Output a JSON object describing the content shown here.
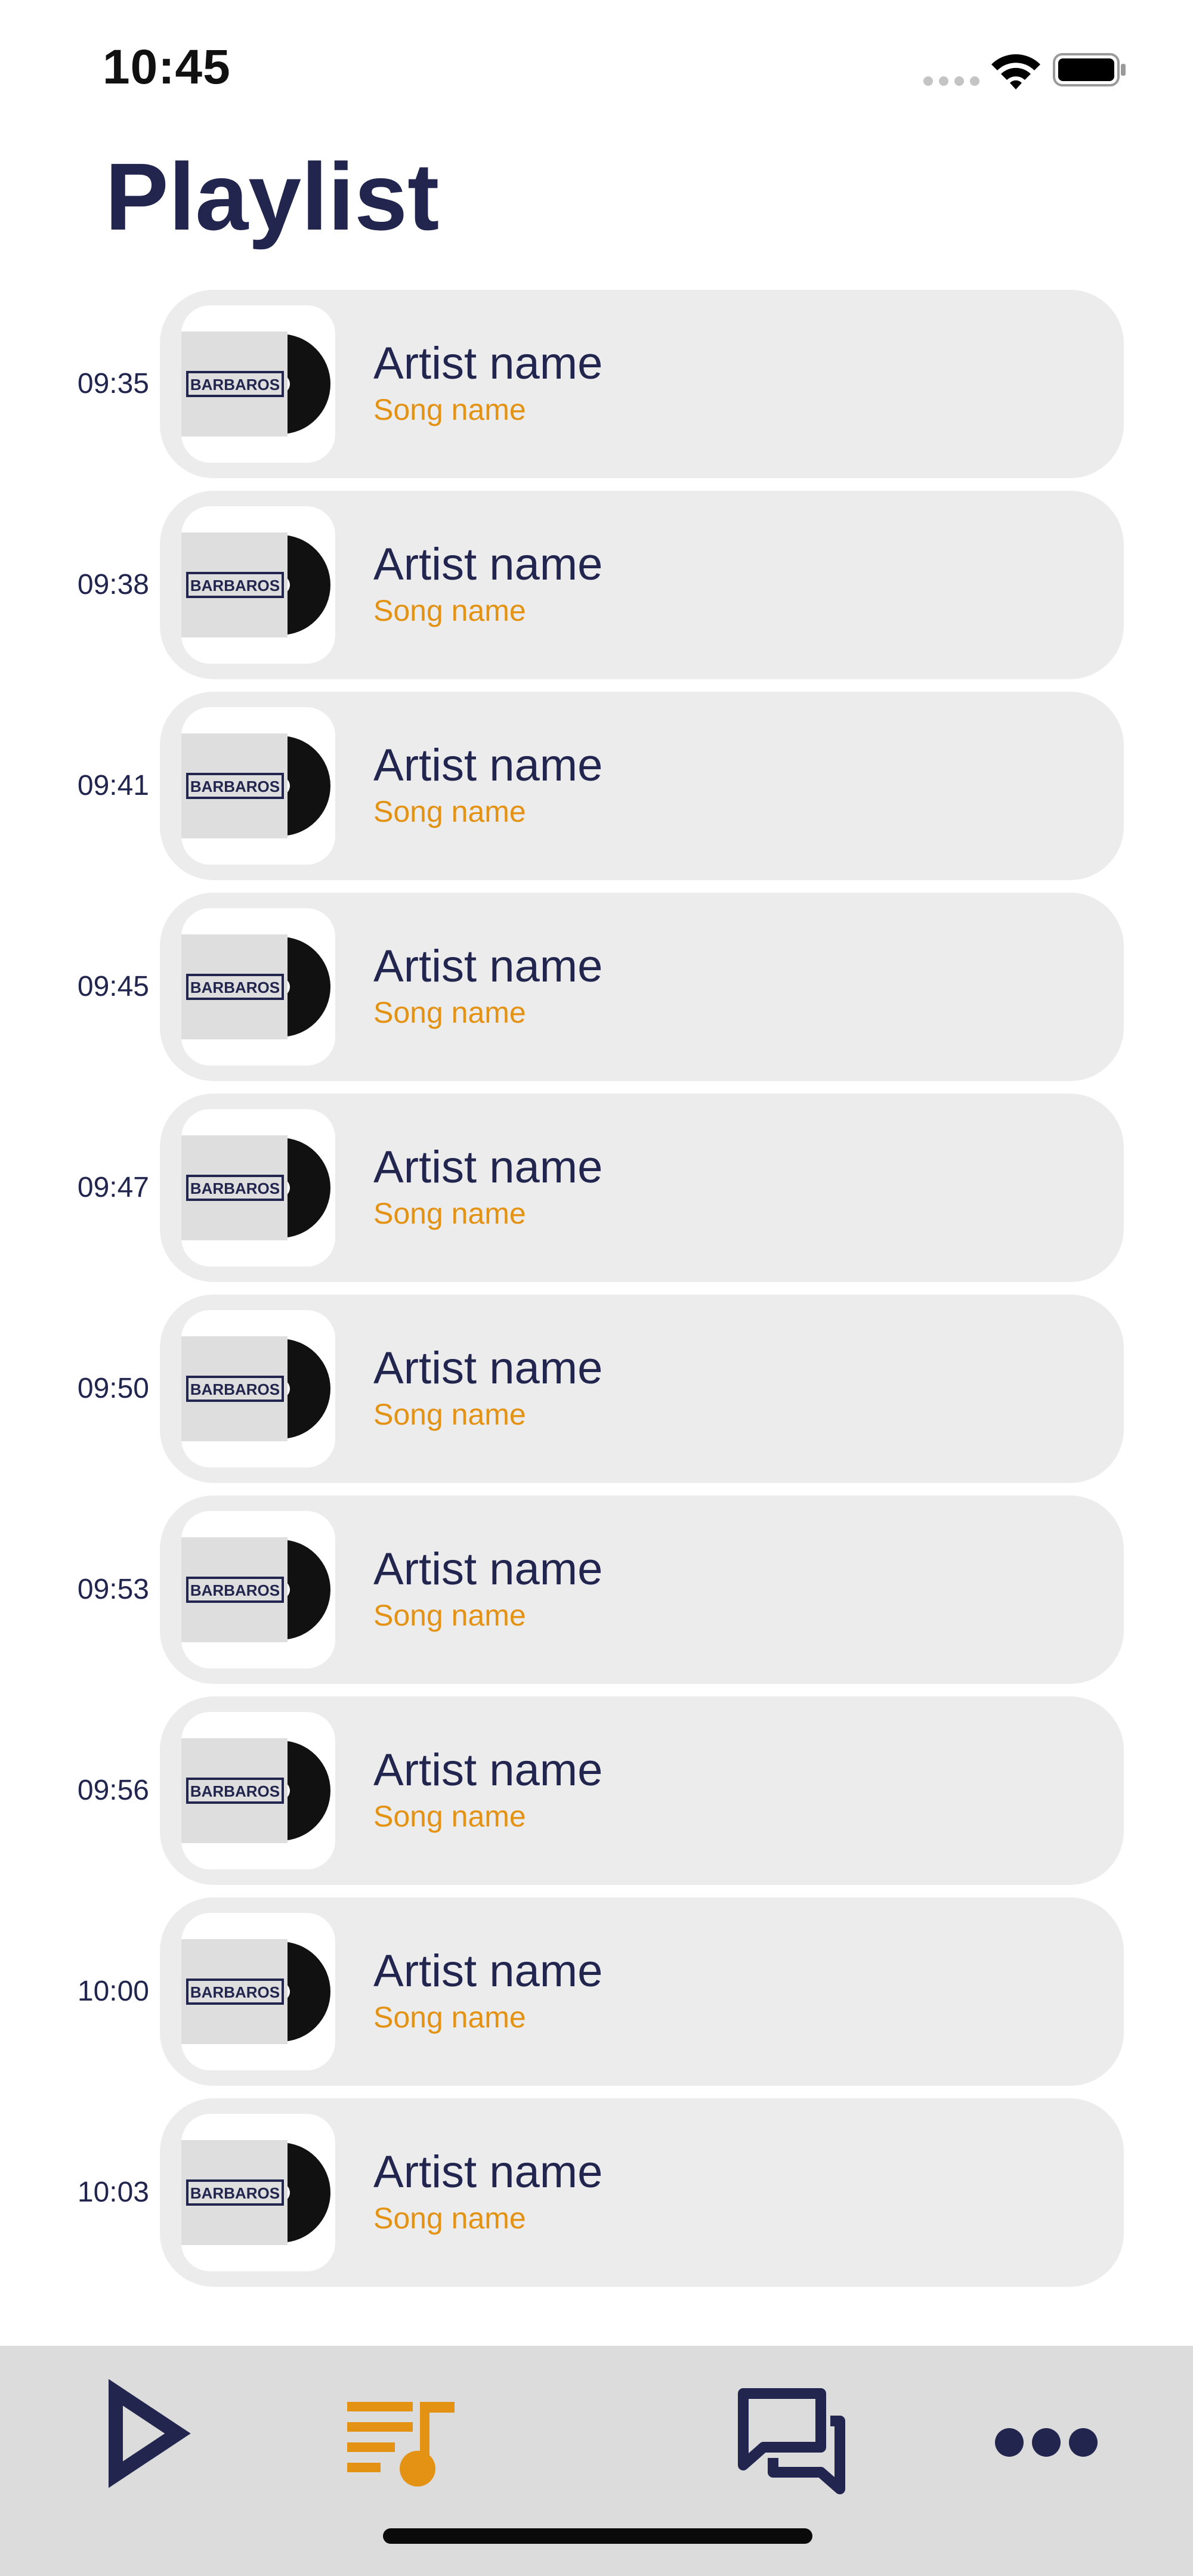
{
  "status_bar": {
    "time": "10:45"
  },
  "header": {
    "title": "Playlist"
  },
  "cover_label": "BARBAROS",
  "playlist": [
    {
      "time": "09:35",
      "artist": "Artist name",
      "song": "Song name"
    },
    {
      "time": "09:38",
      "artist": "Artist name",
      "song": "Song name"
    },
    {
      "time": "09:41",
      "artist": "Artist name",
      "song": "Song name"
    },
    {
      "time": "09:45",
      "artist": "Artist name",
      "song": "Song name"
    },
    {
      "time": "09:47",
      "artist": "Artist name",
      "song": "Song name"
    },
    {
      "time": "09:50",
      "artist": "Artist name",
      "song": "Song name"
    },
    {
      "time": "09:53",
      "artist": "Artist name",
      "song": "Song name"
    },
    {
      "time": "09:56",
      "artist": "Artist name",
      "song": "Song name"
    },
    {
      "time": "10:00",
      "artist": "Artist name",
      "song": "Song name"
    },
    {
      "time": "10:03",
      "artist": "Artist name",
      "song": "Song name"
    }
  ],
  "tab_bar": {
    "tabs": [
      {
        "icon": "play-icon",
        "active": false
      },
      {
        "icon": "playlist-icon",
        "active": true
      },
      {
        "icon": "chat-icon",
        "active": false
      },
      {
        "icon": "more-icon",
        "active": false
      }
    ]
  },
  "colors": {
    "navy": "#22264f",
    "accent": "#e39213",
    "card": "#ececec",
    "tab_bar": "#dcdcdc"
  }
}
